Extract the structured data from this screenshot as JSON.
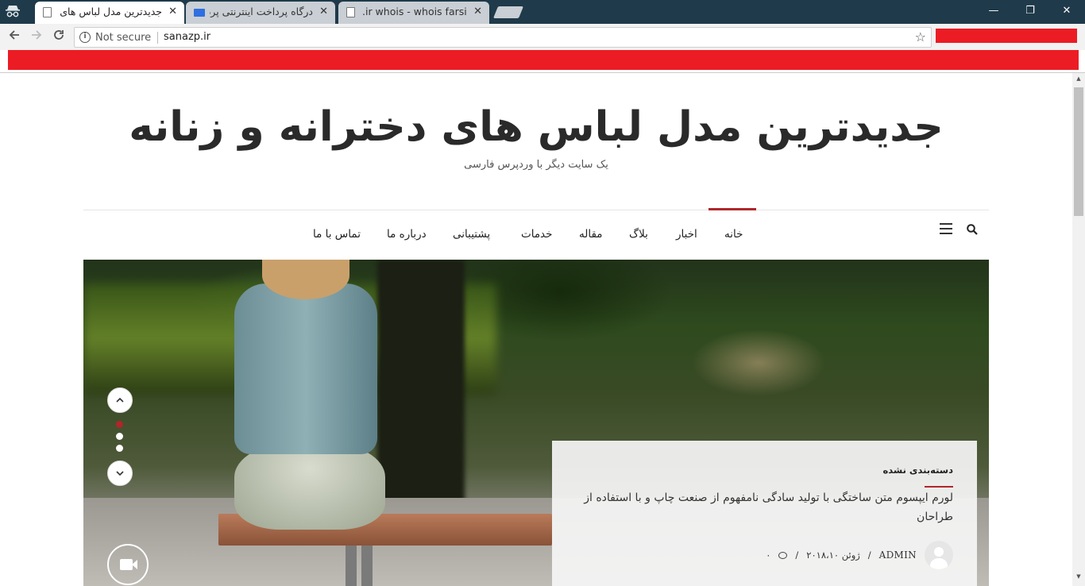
{
  "browser": {
    "tabs": [
      {
        "title": "جدیدترین مدل لباس های دخترانه و زنانه",
        "active": true,
        "icon": "page-icon"
      },
      {
        "title": "درگاه پرداخت اینترنتی پرداخت",
        "active": false,
        "icon": "card-icon"
      },
      {
        "title": ".ir whois - whois farsi sanazp",
        "active": false,
        "icon": "page-icon"
      }
    ],
    "close_glyph": "✕",
    "window_controls": {
      "minimize": "—",
      "maximize": "❐",
      "close": "✕"
    },
    "address": {
      "security_label": "Not secure",
      "url": "sanazp.ir"
    },
    "accent_red": "#ec1c24"
  },
  "site": {
    "title": "جدیدترین مدل لباس های دخترانه و زنانه",
    "tagline": "یک سایت دیگر با وردپرس فارسی",
    "accent": "#b0262a"
  },
  "nav": {
    "items": [
      {
        "label": "خانه",
        "active": true
      },
      {
        "label": "اخبار"
      },
      {
        "label": "بلاگ"
      },
      {
        "label": "مقاله"
      },
      {
        "label": "خدمات"
      },
      {
        "label": "پشتیبانی"
      },
      {
        "label": "درباره ما"
      },
      {
        "label": "تماس با ما"
      }
    ]
  },
  "slider": {
    "dots": [
      {
        "active": true
      },
      {
        "active": false
      },
      {
        "active": false
      }
    ],
    "card": {
      "category": "دسته‌بندی نشده",
      "title": "لورم ایپسوم متن ساختگی با تولید سادگی نامفهوم از صنعت چاپ و با استفاده از طراحان",
      "author": "ADMIN",
      "date": "ژوئن ۲۰۱۸،۱۰",
      "comments": "۰",
      "separator": "/"
    }
  }
}
